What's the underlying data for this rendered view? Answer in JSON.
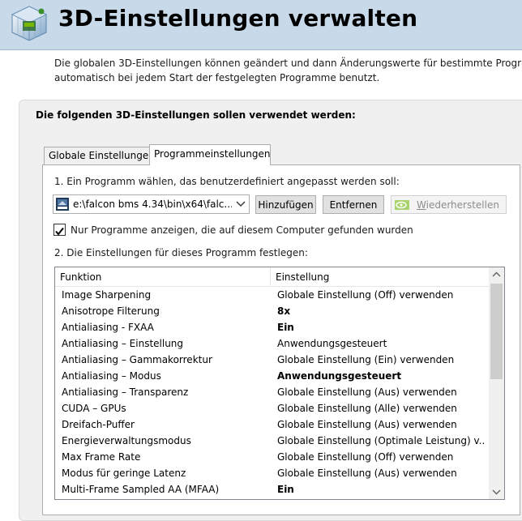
{
  "header": {
    "title": "3D-Einstellungen verwalten",
    "icon": "nvidia-3d-settings-icon"
  },
  "description": {
    "line1": "Die globalen 3D-Einstellungen können geändert und dann Änderungswerte für bestimmte Program",
    "line2": "automatisch bei jedem Start der festgelegten Programme benutzt."
  },
  "panel": {
    "title": "Die folgenden 3D-Einstellungen sollen verwendet werden:"
  },
  "tabs": [
    {
      "label": "Globale Einstellungen",
      "selected": false
    },
    {
      "label": "Programmeinstellungen",
      "selected": true
    }
  ],
  "program": {
    "step1": "1. Ein Programm wählen, das benutzerdefiniert angepasst werden soll:",
    "selected": "e:\\falcon bms 4.34\\bin\\x64\\falc...",
    "add_label": "Hinzufügen",
    "remove_label": "Entfernen",
    "restore_prefix": "W",
    "restore_rest": "iederherstellen",
    "restore_enabled": false,
    "checkbox_label": "Nur Programme anzeigen, die auf diesem Computer gefunden wurden",
    "checkbox_checked": true,
    "step2": "2. Die Einstellungen für dieses Programm festlegen:"
  },
  "settings": {
    "columns": [
      "Funktion",
      "Einstellung"
    ],
    "rows": [
      {
        "feature": "Image Sharpening",
        "value": "Globale Einstellung (Off) verwenden",
        "bold": false
      },
      {
        "feature": "Anisotrope Filterung",
        "value": "8x",
        "bold": true
      },
      {
        "feature": "Antialiasing - FXAA",
        "value": "Ein",
        "bold": true
      },
      {
        "feature": "Antialiasing – Einstellung",
        "value": "Anwendungsgesteuert",
        "bold": false
      },
      {
        "feature": "Antialiasing – Gammakorrektur",
        "value": "Globale Einstellung (Ein) verwenden",
        "bold": false
      },
      {
        "feature": "Antialiasing – Modus",
        "value": "Anwendungsgesteuert",
        "bold": true
      },
      {
        "feature": "Antialiasing – Transparenz",
        "value": "Globale Einstellung (Aus) verwenden",
        "bold": false
      },
      {
        "feature": "CUDA – GPUs",
        "value": "Globale Einstellung (Alle) verwenden",
        "bold": false
      },
      {
        "feature": "Dreifach-Puffer",
        "value": "Globale Einstellung (Aus) verwenden",
        "bold": false
      },
      {
        "feature": "Energieverwaltungsmodus",
        "value": "Globale Einstellung (Optimale Leistung) v...",
        "bold": false
      },
      {
        "feature": "Max Frame Rate",
        "value": "Globale Einstellung (Off) verwenden",
        "bold": false
      },
      {
        "feature": "Modus für geringe Latenz",
        "value": "Globale Einstellung (Aus) verwenden",
        "bold": false
      },
      {
        "feature": "Multi-Frame Sampled AA (MFAA)",
        "value": "Ein",
        "bold": true
      }
    ]
  },
  "colors": {
    "header_bg": "#c8d9ea",
    "panel_bg": "#f0f0f0",
    "nvidia_green": "#76b900"
  }
}
